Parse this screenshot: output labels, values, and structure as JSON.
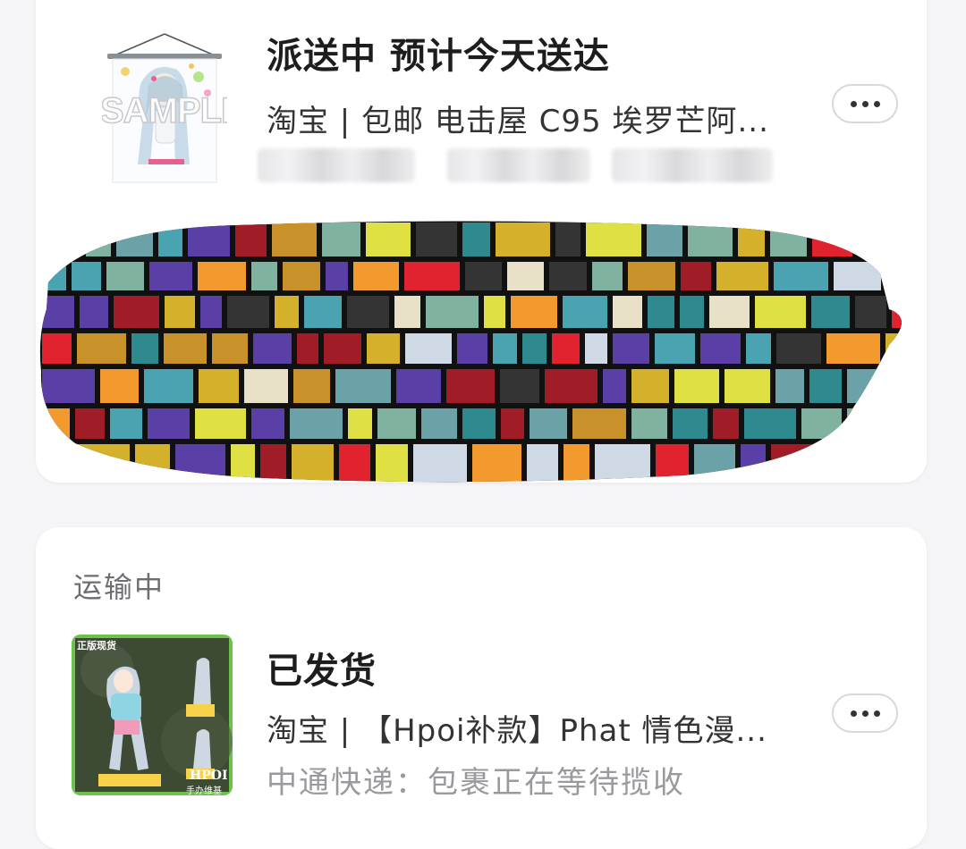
{
  "colors": {
    "background": "#f5f5f7",
    "card": "#ffffff",
    "title_text": "#1d1d1f",
    "muted_text": "#9a9a9e"
  },
  "orders": [
    {
      "thumbnail_label": "SAMPLE",
      "status": "派送中 预计今天送达",
      "description": "淘宝 | 包邮 电击屋 C95 埃罗芒阿...",
      "more_icon": "more-horizontal-icon"
    },
    {
      "section_label": "运输中",
      "thumbnail_badge_top": "正版现货",
      "thumbnail_badge_bottom_1": "HPOI",
      "thumbnail_badge_bottom_2": "手办维基",
      "status": "已发货",
      "description": "淘宝 | 【Hpoi补款】Phat 情色漫...",
      "tracking": "中通快递：包裹正在等待揽收",
      "more_icon": "more-horizontal-icon"
    }
  ]
}
